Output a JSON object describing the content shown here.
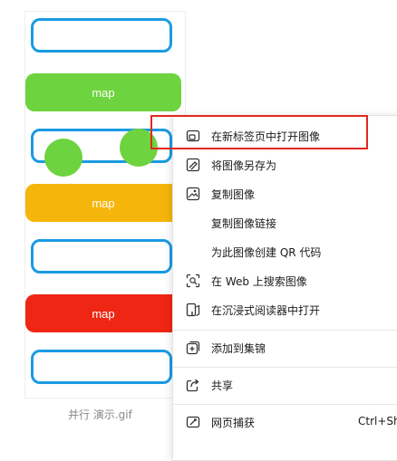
{
  "preview": {
    "items": [
      {
        "kind": "outline"
      },
      {
        "kind": "button",
        "label": "map",
        "color": "#6dd33e"
      },
      {
        "kind": "outline"
      },
      {
        "kind": "button",
        "label": "map",
        "color": "#f5b50a"
      },
      {
        "kind": "outline"
      },
      {
        "kind": "button",
        "label": "map",
        "color": "#ee2613"
      },
      {
        "kind": "outline"
      }
    ],
    "caption": "并行 演示.gif"
  },
  "context_menu": {
    "items": [
      {
        "label": "在新标签页中打开图像",
        "icon": "open-in-new-tab-icon"
      },
      {
        "label": "将图像另存为",
        "icon": "save-image-icon"
      },
      {
        "label": "复制图像",
        "icon": "copy-image-icon"
      },
      {
        "label": "复制图像链接",
        "icon": ""
      },
      {
        "label": "为此图像创建 QR 代码",
        "icon": ""
      },
      {
        "label": "在 Web 上搜索图像",
        "icon": "visual-search-icon"
      },
      {
        "label": "在沉浸式阅读器中打开",
        "icon": "immersive-reader-icon"
      },
      {
        "label": "添加到集锦",
        "icon": "collections-icon"
      },
      {
        "label": "共享",
        "icon": "share-icon"
      },
      {
        "label": "网页捕获",
        "icon": "web-capture-icon",
        "shortcut": "Ctrl+Sh"
      }
    ]
  },
  "highlight_color": "#e2271f"
}
